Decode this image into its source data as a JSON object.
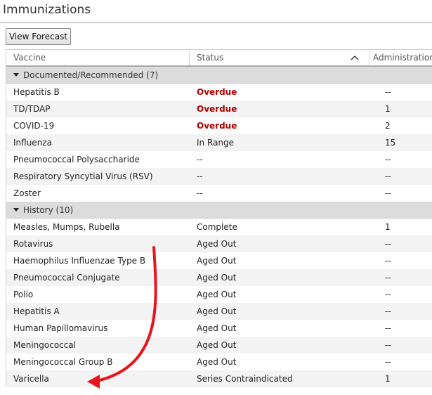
{
  "page": {
    "title": "Immunizations",
    "forecast_button": "View Forecast"
  },
  "columns": {
    "vaccine": "Vaccine",
    "status": "Status",
    "administrations": "Administrations"
  },
  "groups": [
    {
      "label": "Documented/Recommended (7)",
      "rows": [
        {
          "vaccine": "Hepatitis B",
          "status": "Overdue",
          "administrations": "--",
          "overdue": true
        },
        {
          "vaccine": "TD/TDAP",
          "status": "Overdue",
          "administrations": "1",
          "overdue": true
        },
        {
          "vaccine": "COVID-19",
          "status": "Overdue",
          "administrations": "2",
          "overdue": true
        },
        {
          "vaccine": "Influenza",
          "status": "In Range",
          "administrations": "15"
        },
        {
          "vaccine": "Pneumococcal Polysaccharide",
          "status": "--",
          "administrations": "--"
        },
        {
          "vaccine": "Respiratory Syncytial Virus (RSV)",
          "status": "--",
          "administrations": "--"
        },
        {
          "vaccine": "Zoster",
          "status": "--",
          "administrations": "--"
        }
      ]
    },
    {
      "label": "History (10)",
      "rows": [
        {
          "vaccine": "Measles, Mumps, Rubella",
          "status": "Complete",
          "administrations": "1"
        },
        {
          "vaccine": "Rotavirus",
          "status": "Aged Out",
          "administrations": "--"
        },
        {
          "vaccine": "Haemophilus Influenzae Type B",
          "status": "Aged Out",
          "administrations": "--"
        },
        {
          "vaccine": "Pneumococcal Conjugate",
          "status": "Aged Out",
          "administrations": "--"
        },
        {
          "vaccine": "Polio",
          "status": "Aged Out",
          "administrations": "--"
        },
        {
          "vaccine": "Hepatitis A",
          "status": "Aged Out",
          "administrations": "--"
        },
        {
          "vaccine": "Human Papillomavirus",
          "status": "Aged Out",
          "administrations": "--"
        },
        {
          "vaccine": "Meningococcal",
          "status": "Aged Out",
          "administrations": "--"
        },
        {
          "vaccine": "Meningococcal Group B",
          "status": "Aged Out",
          "administrations": "--"
        },
        {
          "vaccine": "Varicella",
          "status": "Series Contraindicated",
          "administrations": "1"
        }
      ]
    }
  ],
  "colors": {
    "overdue": "#b00000",
    "annotation_arrow": "#e8141b",
    "group_band": "#dcdcdc"
  },
  "icons": {
    "sort": "chevron-up-icon",
    "group_toggle": "triangle-down-icon",
    "annotation": "curved-arrow-annotation"
  }
}
